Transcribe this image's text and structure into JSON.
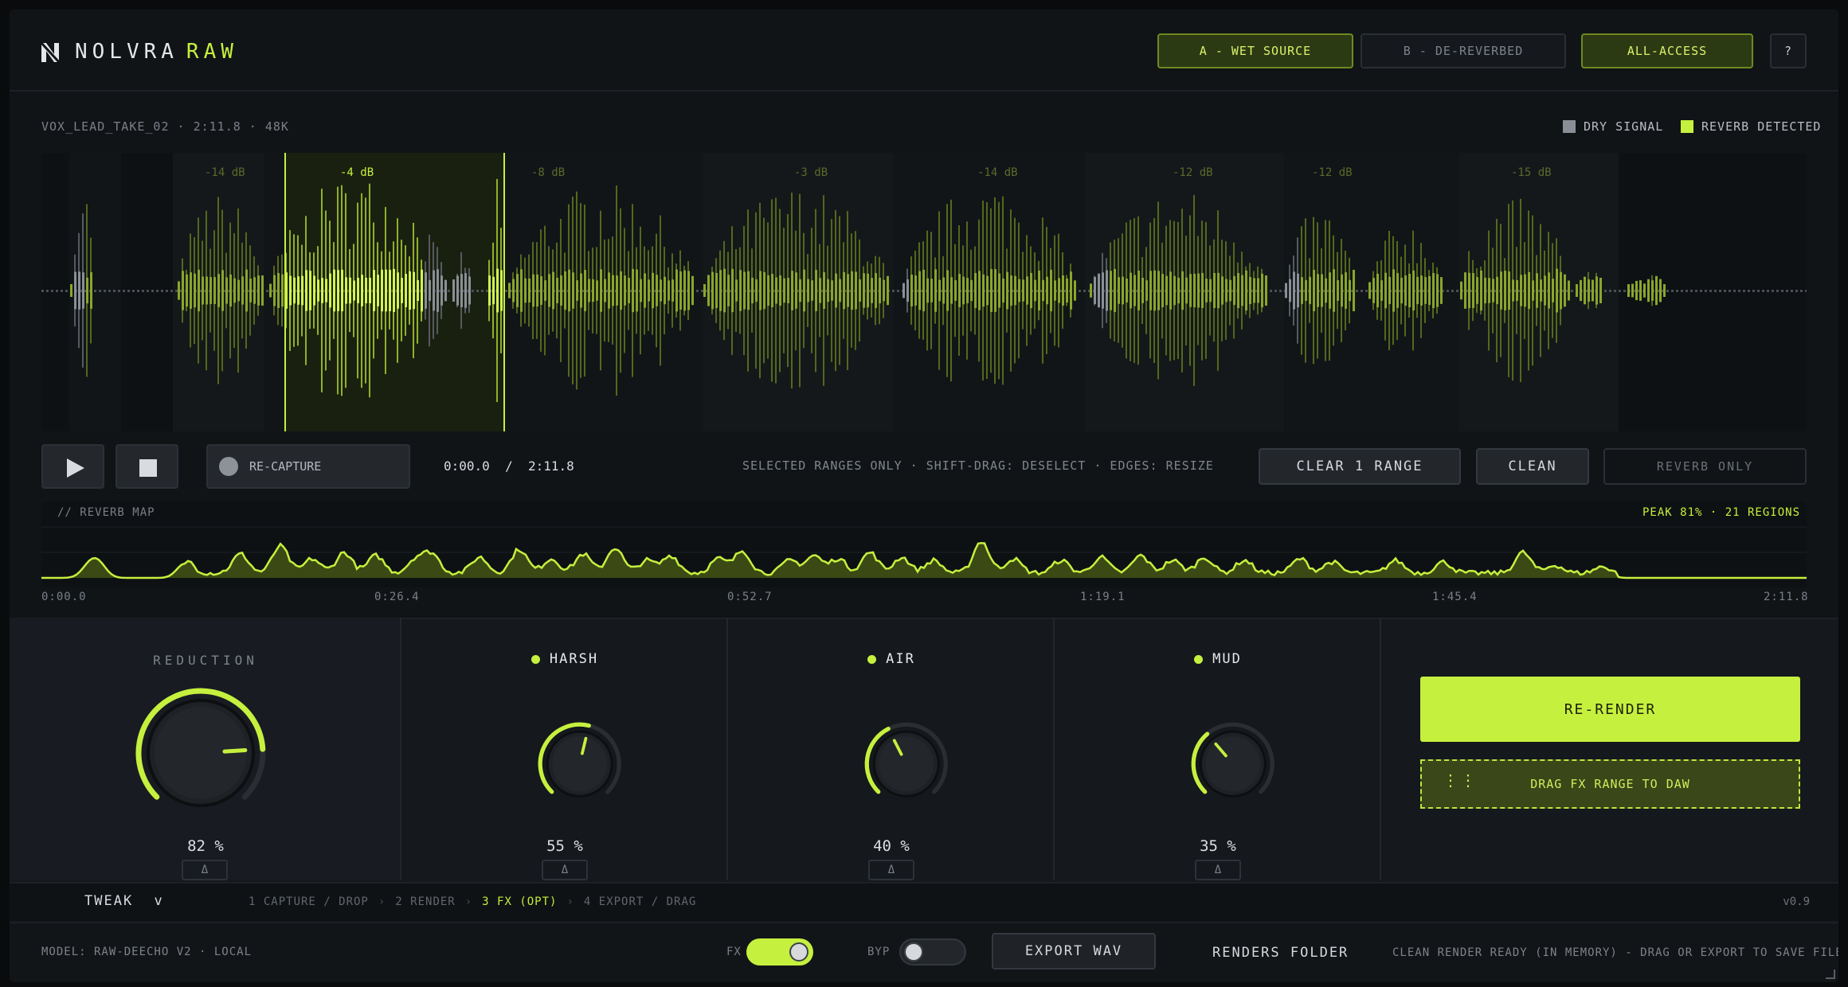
{
  "app": {
    "brand": "NOLVRA",
    "brand_accent": "RAW"
  },
  "header": {
    "buttons": [
      {
        "label": "A - WET SOURCE",
        "active": true
      },
      {
        "label": "B - DE-REVERBED",
        "active": false
      },
      {
        "label": "ALL-ACCESS",
        "active": true
      },
      {
        "label": "?",
        "active": false
      }
    ]
  },
  "file": {
    "info": "VOX_LEAD_TAKE_02 · 2:11.8 · 48K"
  },
  "legend": {
    "dry": "DRY SIGNAL",
    "reverb": "REVERB DETECTED"
  },
  "waveform": {
    "db_labels": [
      "-14 dB",
      "-4 dB",
      "-8 dB",
      "-3 dB",
      "-14 dB",
      "-12 dB",
      "-12 dB",
      "-15 dB"
    ]
  },
  "transport": {
    "play_icon": "play-icon",
    "stop_icon": "stop-icon",
    "recapture_label": "RE-CAPTURE",
    "current_time": "0:00.0",
    "separator": "/",
    "total_time": "2:11.8",
    "hint": "SELECTED RANGES ONLY · SHIFT-DRAG: DESELECT · EDGES: RESIZE",
    "clear_range": "CLEAR 1 RANGE",
    "clean": "CLEAN",
    "reverb_only": "REVERB ONLY"
  },
  "reverb_map": {
    "title": "// REVERB MAP",
    "peak": "PEAK 81% · 21 REGIONS",
    "ticks": [
      "0:00.0",
      "0:26.4",
      "0:52.7",
      "1:19.1",
      "1:45.4",
      "2:11.8"
    ]
  },
  "knobs": [
    {
      "label": "REDUCTION",
      "value": 82,
      "value_text": "82 %",
      "delta": "Δ",
      "indicator": false
    },
    {
      "label": "HARSH",
      "value": 55,
      "value_text": "55 %",
      "delta": "Δ",
      "indicator": true
    },
    {
      "label": "AIR",
      "value": 40,
      "value_text": "40 %",
      "delta": "Δ",
      "indicator": true
    },
    {
      "label": "MUD",
      "value": 35,
      "value_text": "35 %",
      "delta": "Δ",
      "indicator": true
    }
  ],
  "actions": {
    "rerender": "RE-RENDER",
    "drag": "DRAG FX RANGE TO DAW",
    "grip": "⋮⋮"
  },
  "steps": {
    "mode": "TWEAK",
    "mode_caret": "v",
    "items": [
      "1 CAPTURE / DROP",
      "2 RENDER",
      "3 FX (OPT)",
      "4 EXPORT / DRAG"
    ],
    "active_index": 2,
    "separator": "›",
    "version": "v0.9"
  },
  "footer": {
    "model": "MODEL: RAW-DEECHO V2 · LOCAL",
    "fx_label": "FX",
    "fx_on": true,
    "byp_label": "BYP",
    "byp_on": false,
    "export": "EXPORT WAV",
    "renders": "RENDERS FOLDER",
    "status": "CLEAN RENDER READY (IN MEMORY) - DRAG OR EXPORT TO SAVE FILE"
  },
  "colors": {
    "accent": "#c6f03e",
    "dry": "#8a8f97",
    "bg": "#111417"
  }
}
